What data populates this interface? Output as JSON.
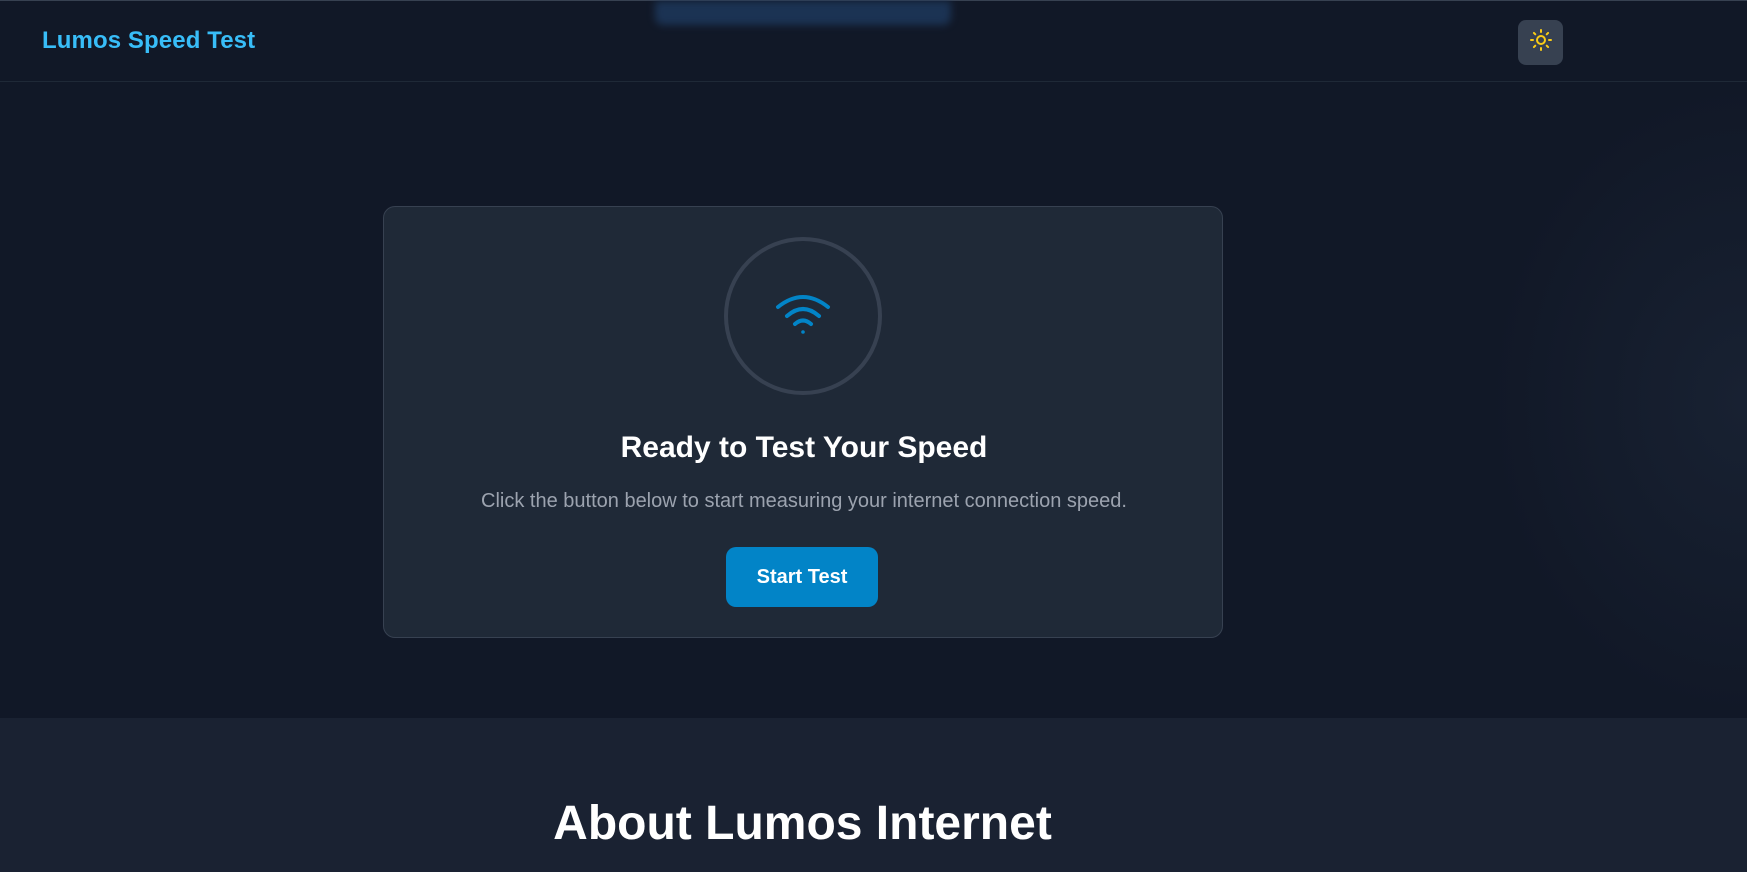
{
  "header": {
    "brand": "Lumos Speed Test",
    "theme_toggle_icon": "sun-icon"
  },
  "card": {
    "icon": "wifi-icon",
    "title": "Ready to Test Your Speed",
    "description": "Click the button below to start measuring your internet connection speed.",
    "start_label": "Start Test"
  },
  "about": {
    "title": "About Lumos Internet"
  },
  "colors": {
    "accent": "#0284c7",
    "brand": "#38bdf8",
    "sun": "#facc15",
    "background": "#111827",
    "card": "#1f2937"
  }
}
